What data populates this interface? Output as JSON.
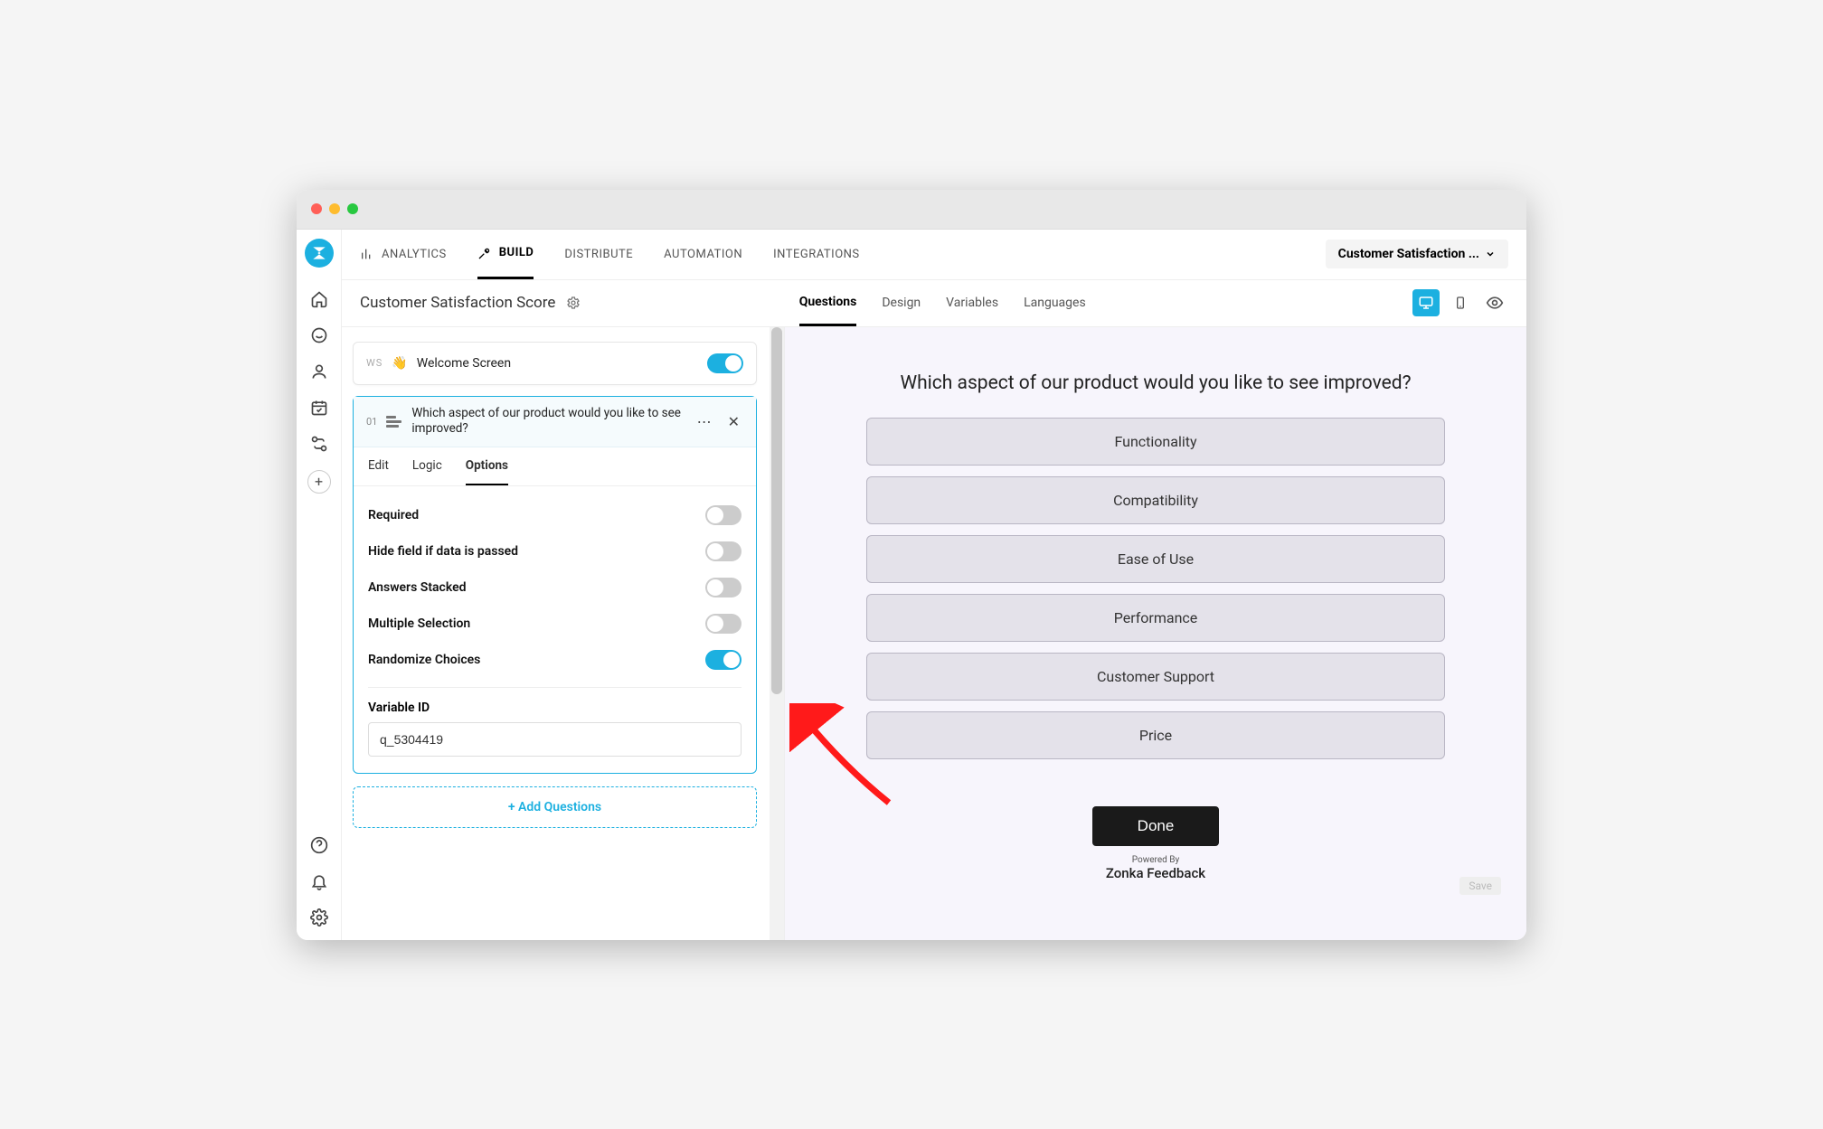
{
  "topnav": {
    "items": [
      {
        "label": "ANALYTICS"
      },
      {
        "label": "BUILD"
      },
      {
        "label": "DISTRIBUTE"
      },
      {
        "label": "AUTOMATION"
      },
      {
        "label": "INTEGRATIONS"
      }
    ],
    "active_index": 1,
    "survey_select": "Customer Satisfaction ..."
  },
  "subheader": {
    "title": "Customer Satisfaction Score",
    "tabs": [
      "Questions",
      "Design",
      "Variables",
      "Languages"
    ],
    "active_tab": 0
  },
  "welcome": {
    "badge": "WS",
    "label": "Welcome Screen",
    "toggle_on": true
  },
  "question": {
    "number": "01",
    "text": "Which aspect of our product would you like to see improved?",
    "tabs": [
      "Edit",
      "Logic",
      "Options"
    ],
    "active_tab": 2,
    "options": [
      {
        "label": "Required",
        "on": false
      },
      {
        "label": "Hide field if data is passed",
        "on": false
      },
      {
        "label": "Answers Stacked",
        "on": false
      },
      {
        "label": "Multiple Selection",
        "on": false
      },
      {
        "label": "Randomize Choices",
        "on": true
      }
    ],
    "variable_id_label": "Variable ID",
    "variable_id_value": "q_5304419"
  },
  "add_questions": "+ Add Questions",
  "preview": {
    "question": "Which aspect of our product would you like to see improved?",
    "choices": [
      "Functionality",
      "Compatibility",
      "Ease of Use",
      "Performance",
      "Customer Support",
      "Price"
    ],
    "done": "Done",
    "powered_small": "Powered By",
    "powered_brand": "Zonka Feedback",
    "save": "Save"
  }
}
